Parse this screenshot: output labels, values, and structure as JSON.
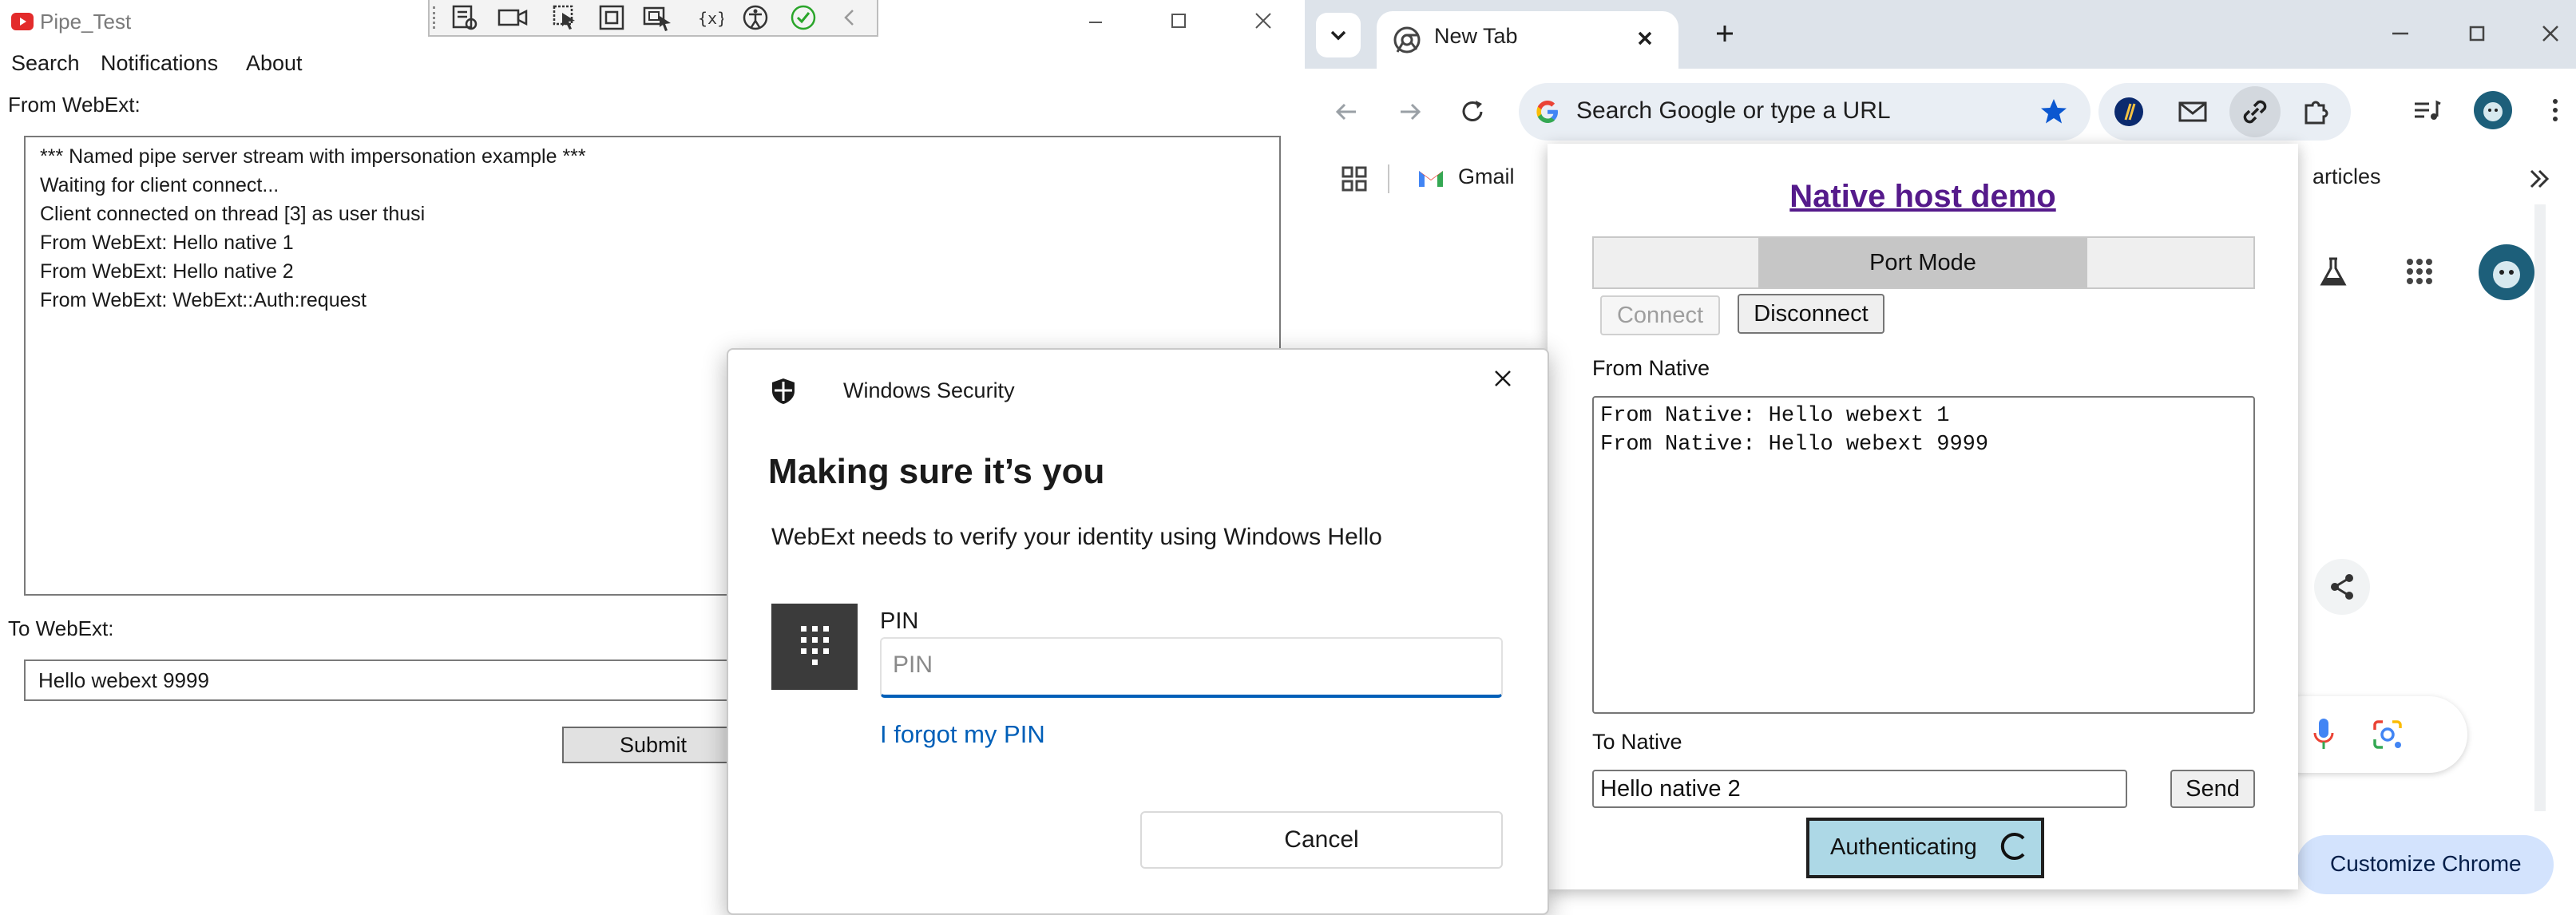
{
  "pipe_window": {
    "title": "Pipe_Test",
    "menu": [
      "Search",
      "Notifications",
      "About"
    ],
    "from_label": "From WebExt:",
    "log_lines": [
      "*** Named pipe server stream with impersonation example ***",
      "Waiting for client connect...",
      "Client connected on thread [3] as user thusi",
      "From WebExt: Hello native 1",
      "From WebExt: Hello native 2",
      "From WebExt: WebExt::Auth:request"
    ],
    "to_label": "To WebExt:",
    "to_value": "Hello webext 9999",
    "submit_label": "Submit"
  },
  "chrome": {
    "tab_title": "New Tab",
    "omnibox_placeholder": "Search Google or type a URL",
    "bookmark_gmail": "Gmail",
    "bookmark_articles": "articles",
    "customize_label": "Customize Chrome"
  },
  "popup": {
    "title": "Native host demo",
    "mode_selected": "Port Mode",
    "connect_label": "Connect",
    "disconnect_label": "Disconnect",
    "from_native_label": "From Native",
    "native_lines": [
      "From Native: Hello webext 1",
      "From Native: Hello webext 9999"
    ],
    "to_native_label": "To Native",
    "to_native_value": "Hello native 2",
    "send_label": "Send",
    "auth_label": "Authenticating"
  },
  "security_dialog": {
    "app_title": "Windows Security",
    "heading": "Making sure it’s you",
    "description": "WebExt needs to verify your identity using Windows Hello",
    "pin_label": "PIN",
    "pin_placeholder": "PIN",
    "forgot_label": "I forgot my PIN",
    "cancel_label": "Cancel"
  },
  "colors": {
    "link_blue": "#005fb8",
    "popup_title": "#551a8b",
    "auth_bg": "#add8e6",
    "chrome_frame": "#dde3ea"
  }
}
